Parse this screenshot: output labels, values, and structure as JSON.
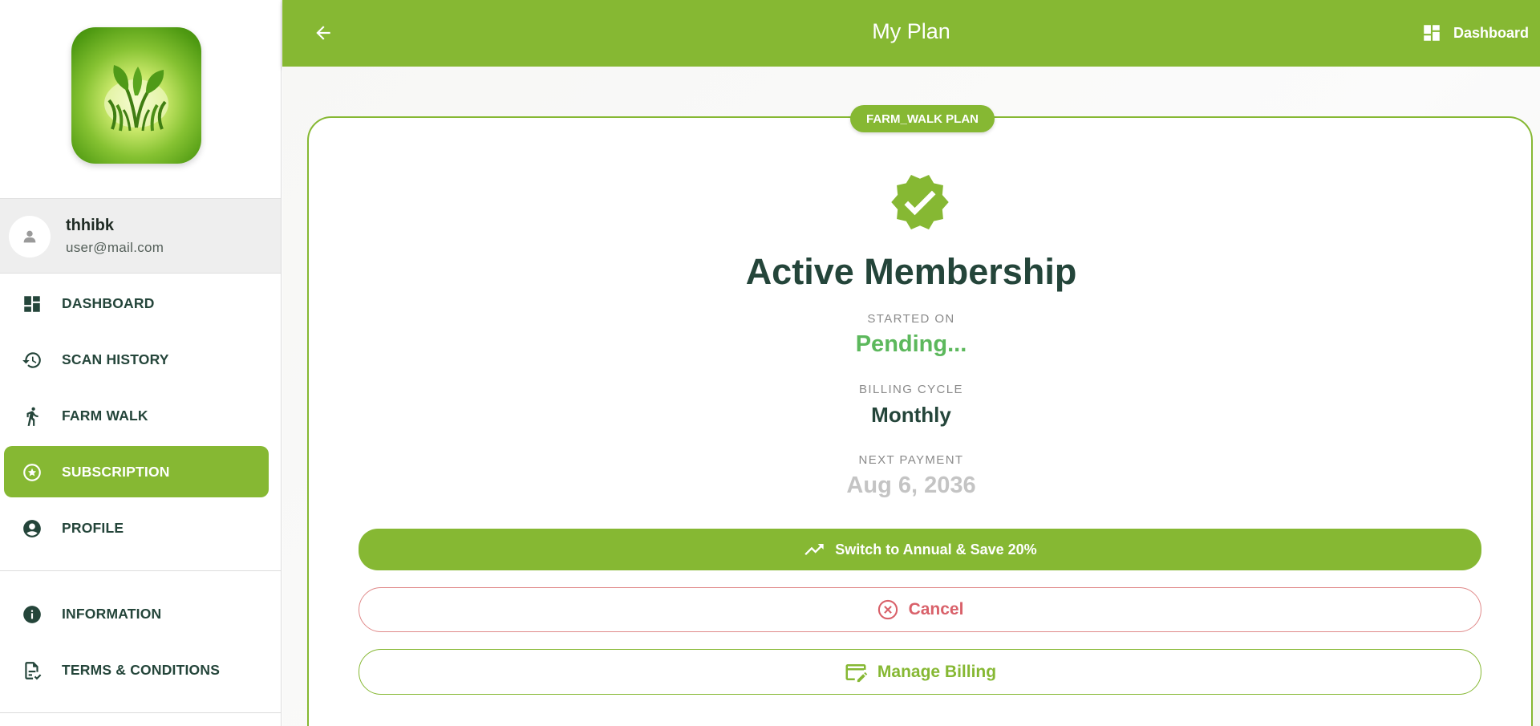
{
  "header": {
    "title": "My Plan",
    "dashboard_label": "Dashboard"
  },
  "user": {
    "name": "thhibk",
    "email": "user@mail.com"
  },
  "sidebar": {
    "items": [
      {
        "label": "DASHBOARD",
        "icon": "dashboard-icon"
      },
      {
        "label": "SCAN HISTORY",
        "icon": "history-icon"
      },
      {
        "label": "FARM WALK",
        "icon": "walk-icon"
      },
      {
        "label": "SUBSCRIPTION",
        "icon": "star-circle-icon",
        "active": true
      },
      {
        "label": "PROFILE",
        "icon": "account-circle-icon"
      }
    ],
    "secondary_items": [
      {
        "label": "INFORMATION",
        "icon": "info-icon"
      },
      {
        "label": "TERMS & CONDITIONS",
        "icon": "document-check-icon"
      }
    ]
  },
  "plan": {
    "badge": "FARM_WALK PLAN",
    "status_title": "Active Membership",
    "started_on_label": "STARTED ON",
    "started_on_value": "Pending...",
    "billing_cycle_label": "BILLING CYCLE",
    "billing_cycle_value": "Monthly",
    "next_payment_label": "NEXT PAYMENT",
    "next_payment_value": "Aug 6, 2036"
  },
  "actions": {
    "switch_annual": "Switch to Annual & Save 20%",
    "cancel": "Cancel",
    "manage_billing": "Manage Billing"
  },
  "colors": {
    "primary": "#86b833",
    "dark_text": "#24453a",
    "pending": "#5cb85c",
    "muted_value": "#c4c4c4",
    "danger": "#d9616a"
  }
}
